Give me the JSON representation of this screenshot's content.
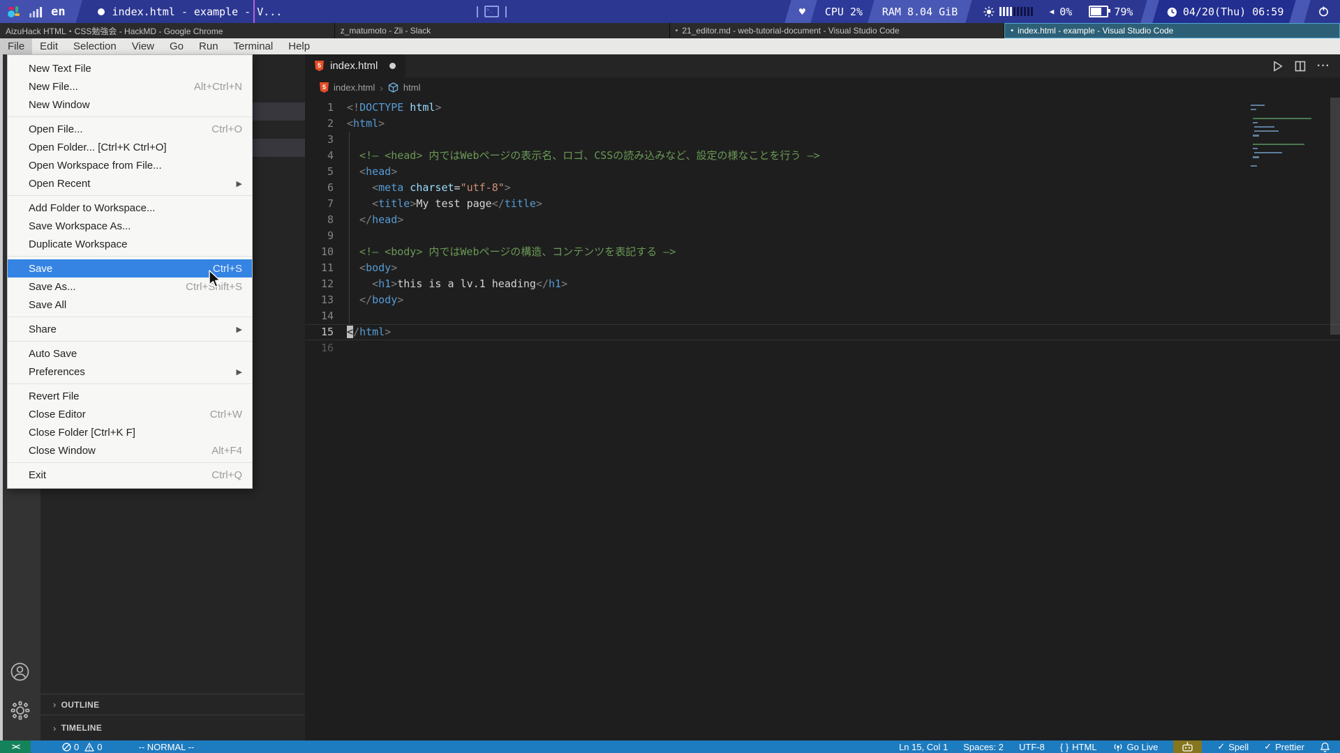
{
  "top_panel": {
    "keyboard_layout": "en",
    "window_title": "index.html - example - V...",
    "cpu": "CPU 2%",
    "ram": "RAM 8.04 GiB",
    "volume": "0%",
    "battery": "79%",
    "clock": "04/20(Thu) 06:59"
  },
  "taskbar": {
    "windows": [
      {
        "title": "AizuHack HTML・CSS勉強会 - HackMD - Google Chrome",
        "active": false,
        "modified": false
      },
      {
        "title": "z_matumoto - Zli - Slack",
        "active": false,
        "modified": false
      },
      {
        "title": "21_editor.md - web-tutorial-document - Visual Studio Code",
        "active": false,
        "modified": true
      },
      {
        "title": "index.html - example - Visual Studio Code",
        "active": true,
        "modified": true
      }
    ]
  },
  "menubar": {
    "items": [
      "File",
      "Edit",
      "Selection",
      "View",
      "Go",
      "Run",
      "Terminal",
      "Help"
    ],
    "active": "File"
  },
  "file_menu": {
    "groups": [
      [
        {
          "label": "New Text File"
        },
        {
          "label": "New File...",
          "shortcut": "Alt+Ctrl+N"
        },
        {
          "label": "New Window"
        }
      ],
      [
        {
          "label": "Open File...",
          "shortcut": "Ctrl+O"
        },
        {
          "label": "Open Folder... [Ctrl+K Ctrl+O]"
        },
        {
          "label": "Open Workspace from File..."
        },
        {
          "label": "Open Recent",
          "submenu": true
        }
      ],
      [
        {
          "label": "Add Folder to Workspace..."
        },
        {
          "label": "Save Workspace As..."
        },
        {
          "label": "Duplicate Workspace"
        }
      ],
      [
        {
          "label": "Save",
          "shortcut": "Ctrl+S",
          "highlighted": true
        },
        {
          "label": "Save As...",
          "shortcut": "Ctrl+Shift+S"
        },
        {
          "label": "Save All"
        }
      ],
      [
        {
          "label": "Share",
          "submenu": true
        }
      ],
      [
        {
          "label": "Auto Save"
        },
        {
          "label": "Preferences",
          "submenu": true
        }
      ],
      [
        {
          "label": "Revert File"
        },
        {
          "label": "Close Editor",
          "shortcut": "Ctrl+W"
        },
        {
          "label": "Close Folder [Ctrl+K F]"
        },
        {
          "label": "Close Window",
          "shortcut": "Alt+F4"
        }
      ],
      [
        {
          "label": "Exit",
          "shortcut": "Ctrl+Q"
        }
      ]
    ]
  },
  "sidebar": {
    "outline_label": "OUTLINE",
    "timeline_label": "TIMELINE"
  },
  "editor": {
    "tab_name": "index.html",
    "breadcrumb_file": "index.html",
    "breadcrumb_symbol": "html",
    "lines": [
      {
        "n": 1,
        "tokens": [
          [
            "punct",
            "<!"
          ],
          [
            "tag",
            "DOCTYPE"
          ],
          [
            "attr",
            " html"
          ],
          [
            "punct",
            ">"
          ]
        ]
      },
      {
        "n": 2,
        "tokens": [
          [
            "punct",
            "<"
          ],
          [
            "tag",
            "html"
          ],
          [
            "punct",
            ">"
          ]
        ]
      },
      {
        "n": 3,
        "guide": true,
        "tokens": []
      },
      {
        "n": 4,
        "guide": true,
        "tokens": [
          [
            "comment",
            "  <!— <head> 内ではWebページの表示名、ロゴ、CSSの読み込みなど、設定の様なことを行う —>"
          ]
        ]
      },
      {
        "n": 5,
        "guide": true,
        "tokens": [
          [
            "punct",
            "  <"
          ],
          [
            "tag",
            "head"
          ],
          [
            "punct",
            ">"
          ]
        ]
      },
      {
        "n": 6,
        "guide": true,
        "tokens": [
          [
            "punct",
            "    <"
          ],
          [
            "tag",
            "meta"
          ],
          [
            "attr",
            " charset"
          ],
          [
            "op",
            "="
          ],
          [
            "string",
            "\"utf-8\""
          ],
          [
            "punct",
            ">"
          ]
        ]
      },
      {
        "n": 7,
        "guide": true,
        "tokens": [
          [
            "punct",
            "    <"
          ],
          [
            "tag",
            "title"
          ],
          [
            "punct",
            ">"
          ],
          [
            "text",
            "My test page"
          ],
          [
            "punct",
            "</"
          ],
          [
            "tag",
            "title"
          ],
          [
            "punct",
            ">"
          ]
        ]
      },
      {
        "n": 8,
        "guide": true,
        "tokens": [
          [
            "punct",
            "  </"
          ],
          [
            "tag",
            "head"
          ],
          [
            "punct",
            ">"
          ]
        ]
      },
      {
        "n": 9,
        "guide": true,
        "tokens": []
      },
      {
        "n": 10,
        "guide": true,
        "tokens": [
          [
            "comment",
            "  <!— <body> 内ではWebページの構造、コンテンツを表記する —>"
          ]
        ]
      },
      {
        "n": 11,
        "guide": true,
        "tokens": [
          [
            "punct",
            "  <"
          ],
          [
            "tag",
            "body"
          ],
          [
            "punct",
            ">"
          ]
        ]
      },
      {
        "n": 12,
        "guide": true,
        "tokens": [
          [
            "punct",
            "    <"
          ],
          [
            "tag",
            "h1"
          ],
          [
            "punct",
            ">"
          ],
          [
            "text",
            "this is a lv.1 heading"
          ],
          [
            "punct",
            "</"
          ],
          [
            "tag",
            "h1"
          ],
          [
            "punct",
            ">"
          ]
        ]
      },
      {
        "n": 13,
        "guide": true,
        "tokens": [
          [
            "punct",
            "  </"
          ],
          [
            "tag",
            "body"
          ],
          [
            "punct",
            ">"
          ]
        ]
      },
      {
        "n": 14,
        "guide": true,
        "tokens": []
      },
      {
        "n": 15,
        "current": true,
        "tokens": [
          [
            "cursor",
            "<"
          ],
          [
            "punct",
            "/"
          ],
          [
            "tag",
            "html"
          ],
          [
            "punct",
            ">"
          ]
        ]
      },
      {
        "n": 16,
        "dim": true,
        "tokens": []
      }
    ]
  },
  "statusbar": {
    "errors": "0",
    "warnings": "0",
    "mode": "-- NORMAL --",
    "line_col": "Ln 15, Col 1",
    "indentation": "Spaces: 2",
    "encoding": "UTF-8",
    "language": "HTML",
    "language_icon": "{ }",
    "go_live": "Go Live",
    "spell": "Spell",
    "prettier": "Prettier",
    "check_glyph": "✓"
  }
}
